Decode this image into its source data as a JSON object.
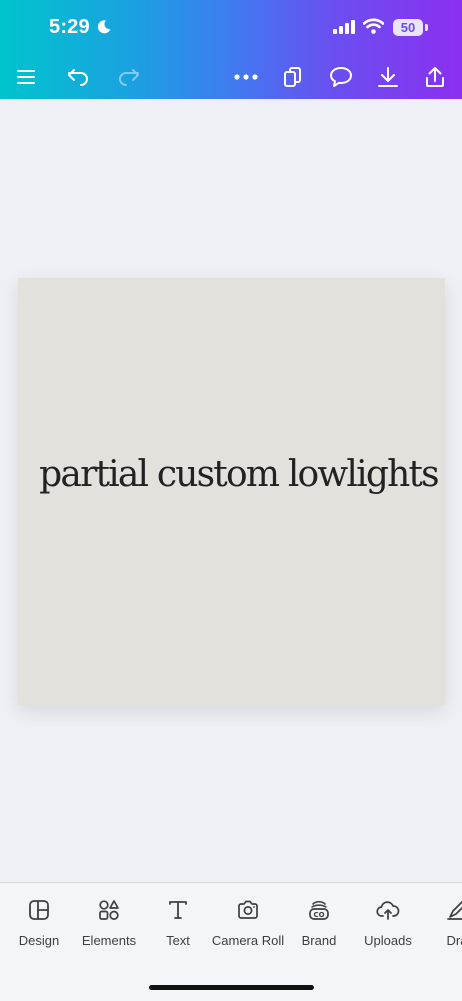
{
  "status": {
    "time": "5:29",
    "battery": "50"
  },
  "toolbar": {
    "icons": [
      "menu-icon",
      "undo-icon",
      "redo-icon",
      "more-icon",
      "pages-icon",
      "comment-icon",
      "download-icon",
      "share-icon"
    ]
  },
  "canvas": {
    "text": "partial custom lowlights",
    "background": "#e3e1dc"
  },
  "bottom_nav": {
    "items": [
      {
        "label": "Design",
        "icon": "design-icon"
      },
      {
        "label": "Elements",
        "icon": "elements-icon"
      },
      {
        "label": "Text",
        "icon": "text-icon"
      },
      {
        "label": "Camera Roll",
        "icon": "camera-icon"
      },
      {
        "label": "Brand",
        "icon": "brand-icon"
      },
      {
        "label": "Uploads",
        "icon": "uploads-icon"
      },
      {
        "label": "Dra",
        "icon": "draw-icon"
      }
    ]
  },
  "colors": {
    "header_gradient_start": "#00c4cc",
    "header_gradient_end": "#8b2ff0",
    "page_background": "#eef0f5"
  }
}
